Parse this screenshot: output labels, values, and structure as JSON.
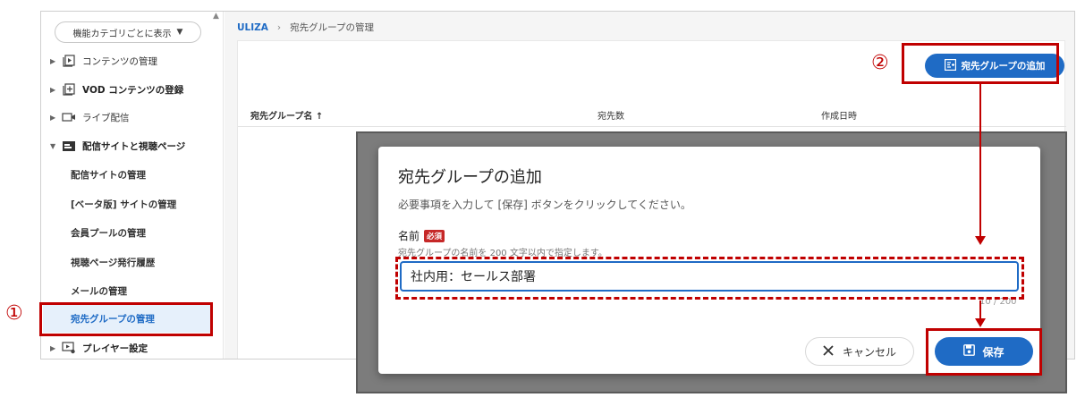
{
  "sidebar": {
    "category_button": "機能カテゴリごとに表示",
    "items": [
      {
        "label": "コンテンツの管理"
      },
      {
        "label": "VOD コンテンツの登録"
      },
      {
        "label": "ライブ配信"
      },
      {
        "label": "配信サイトと視聴ページ"
      },
      {
        "label": "プレイヤー設定"
      }
    ],
    "subitems": [
      {
        "label": "配信サイトの管理"
      },
      {
        "label": "[ベータ版] サイトの管理"
      },
      {
        "label": "会員プールの管理"
      },
      {
        "label": "視聴ページ発行履歴"
      },
      {
        "label": "メールの管理"
      },
      {
        "label": "宛先グループの管理"
      }
    ]
  },
  "breadcrumb": {
    "home": "ULIZA",
    "sep": "›",
    "current": "宛先グループの管理"
  },
  "page": {
    "add_button": "宛先グループの追加",
    "columns": [
      "宛先グループ名",
      "宛先数",
      "作成日時"
    ],
    "sort_indicator": "↑"
  },
  "dialog": {
    "title": "宛先グループの追加",
    "description": "必要事項を入力して [保存] ボタンをクリックしてください。",
    "field_label": "名前",
    "required": "必須",
    "field_help": "宛先グループの名前を 200 文字以内で指定します。",
    "field_value": "社内用：セールス部署",
    "char_count": "10 / 200",
    "cancel": "キャンセル",
    "save": "保存"
  },
  "annotations": {
    "step1": "①",
    "step2": "②"
  },
  "colors": {
    "accent": "#1f6bc5",
    "annotation": "#c00000",
    "required": "#c62828"
  }
}
